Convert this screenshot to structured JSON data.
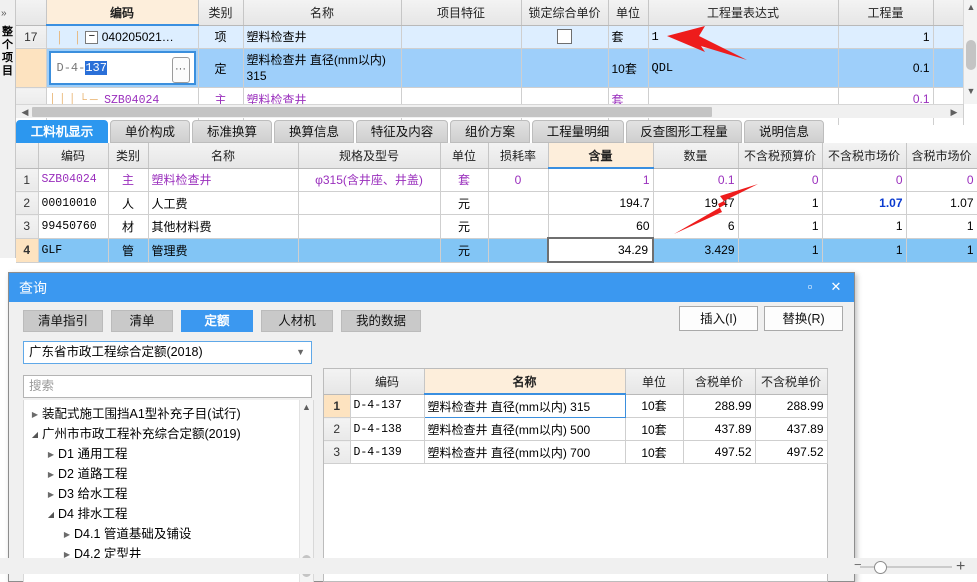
{
  "left_strip": {
    "expander": "»",
    "label": "整个项目"
  },
  "top_grid": {
    "columns": [
      "",
      "编码",
      "类别",
      "名称",
      "项目特征",
      "锁定综合单价",
      "单位",
      "工程量表达式",
      "工程量",
      ""
    ],
    "rows": [
      {
        "idx": "17",
        "code": "040205021…",
        "type": "项",
        "name": "塑料检查井",
        "feature": "",
        "lock": "checkbox",
        "unit": "套",
        "expr": "1",
        "qty": "1",
        "state": "light"
      },
      {
        "idx": "",
        "code": "D-4-137",
        "code_prefix": "D-4-",
        "code_sel": "137",
        "type": "定",
        "name": "塑料检查井  直径(mm以内)\n315",
        "feature": "",
        "lock": "",
        "unit": "10套",
        "expr": "QDL",
        "qty": "0.1",
        "state": "selected-editing"
      },
      {
        "idx": "",
        "code": "SZB04024",
        "type": "主",
        "name": "塑料检查井",
        "feature": "",
        "lock": "",
        "unit": "套",
        "expr": "",
        "qty": "0.1",
        "state": "purple"
      }
    ]
  },
  "tabs": [
    {
      "label": "工料机显示",
      "active": true
    },
    {
      "label": "单价构成",
      "active": false
    },
    {
      "label": "标准换算",
      "active": false
    },
    {
      "label": "换算信息",
      "active": false
    },
    {
      "label": "特征及内容",
      "active": false
    },
    {
      "label": "组价方案",
      "active": false
    },
    {
      "label": "工程量明细",
      "active": false
    },
    {
      "label": "反查图形工程量",
      "active": false
    },
    {
      "label": "说明信息",
      "active": false
    }
  ],
  "detail_grid": {
    "columns": [
      "",
      "编码",
      "类别",
      "名称",
      "规格及型号",
      "单位",
      "损耗率",
      "含量",
      "数量",
      "不含税预算价",
      "不含税市场价",
      "含税市场价"
    ],
    "highlight_column": "含量",
    "rows": [
      {
        "idx": "1",
        "code": "SZB04024",
        "type": "主",
        "name": "塑料检查井",
        "spec": "φ315(含井座、井盖)",
        "unit": "套",
        "loss": "0",
        "content": "1",
        "qty": "0.1",
        "budget_price": "0",
        "market_price_ex": "0",
        "market_price_inc": "0",
        "state": "purple"
      },
      {
        "idx": "2",
        "code": "00010010",
        "type": "人",
        "name": "人工费",
        "spec": "",
        "unit": "元",
        "loss": "",
        "content": "194.7",
        "qty": "19.47",
        "budget_price": "1",
        "market_price_ex": "1.07",
        "market_price_inc": "1.07",
        "state": "normal",
        "market_ex_bold": true
      },
      {
        "idx": "3",
        "code": "99450760",
        "type": "材",
        "name": "其他材料费",
        "spec": "",
        "unit": "元",
        "loss": "",
        "content": "60",
        "qty": "6",
        "budget_price": "1",
        "market_price_ex": "1",
        "market_price_inc": "1",
        "state": "normal"
      },
      {
        "idx": "4",
        "code": "GLF",
        "type": "管",
        "name": "管理费",
        "spec": "",
        "unit": "元",
        "loss": "",
        "content": "34.29",
        "qty": "3.429",
        "budget_price": "1",
        "market_price_ex": "1",
        "market_price_inc": "1",
        "state": "selected"
      }
    ]
  },
  "dialog": {
    "title": "查询",
    "maximize_icon": "▫",
    "close_icon": "✕",
    "tabs": [
      {
        "label": "清单指引",
        "active": false
      },
      {
        "label": "清单",
        "active": false
      },
      {
        "label": "定额",
        "active": true
      },
      {
        "label": "人材机",
        "active": false
      },
      {
        "label": "我的数据",
        "active": false
      }
    ],
    "buttons": [
      {
        "label": "插入(I)"
      },
      {
        "label": "替换(R)"
      }
    ],
    "combo": {
      "value": "广东省市政工程综合定额(2018)",
      "arrow": "▼"
    },
    "search": {
      "placeholder": "搜索",
      "value": ""
    },
    "tree": [
      {
        "label": "装配式施工围挡A1型补充子目(试行)",
        "depth": 0,
        "expanded": false
      },
      {
        "label": "广州市市政工程补充综合定额(2019)",
        "depth": 0,
        "expanded": true
      },
      {
        "label": "D1  通用工程",
        "depth": 1,
        "expanded": false
      },
      {
        "label": "D2  道路工程",
        "depth": 1,
        "expanded": false
      },
      {
        "label": "D3  给水工程",
        "depth": 1,
        "expanded": false
      },
      {
        "label": "D4  排水工程",
        "depth": 1,
        "expanded": true
      },
      {
        "label": "D4.1  管道基础及铺设",
        "depth": 2,
        "expanded": false
      },
      {
        "label": "D4.2  定型井",
        "depth": 2,
        "expanded": false
      }
    ],
    "grid": {
      "columns": [
        "",
        "编码",
        "名称",
        "单位",
        "含税单价",
        "不含税单价"
      ],
      "rows": [
        {
          "idx": "1",
          "code": "D-4-137",
          "name": "塑料检查井  直径(mm以内) 315",
          "unit": "10套",
          "price_inc": "288.99",
          "price_ex": "288.99",
          "editing": true
        },
        {
          "idx": "2",
          "code": "D-4-138",
          "name": "塑料检查井  直径(mm以内) 500",
          "unit": "10套",
          "price_inc": "437.89",
          "price_ex": "437.89",
          "editing": false
        },
        {
          "idx": "3",
          "code": "D-4-139",
          "name": "塑料检查井  直径(mm以内) 700",
          "unit": "10套",
          "price_inc": "497.52",
          "price_ex": "497.52",
          "editing": false
        }
      ]
    }
  },
  "zoom_slider": {
    "minus": "−",
    "plus": "+"
  },
  "colors": {
    "accent": "#3b98f0",
    "selection": "#82c5f5",
    "highlight_header": "#fdeedb",
    "purple_text": "#9a2fbd",
    "annotation_arrow": "#ee1c1c"
  }
}
